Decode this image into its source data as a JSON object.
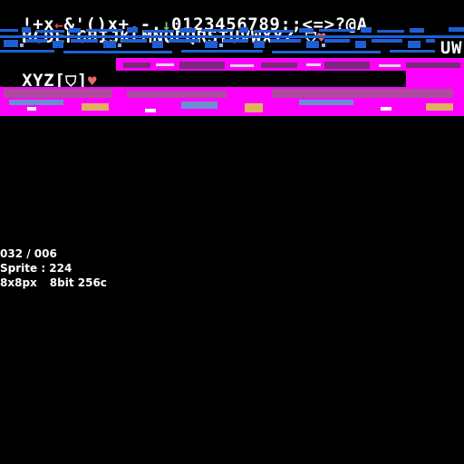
{
  "sheet": {
    "row1_text": "!+x",
    "row1_text2": "&'()x+,-.",
    "row1_text3": "0123456789:;<=>?@A",
    "row2_text": "BCDEFGHIJKLMNOPQRSTUVWXYZ",
    "row2_tail": "UW",
    "row3_text": "XYZ[",
    "row3_text2": "]",
    "icons": [
      "left-arrow-icon",
      "down-arrow-icon",
      "shield-icon",
      "heart-icon"
    ],
    "colors": {
      "background": "#000000",
      "font_white": "#ffffff",
      "blue": "#1f5fd6",
      "magenta": "#ff00ff",
      "heart": "#e86a6a",
      "arrow_red": "#e84a4a",
      "arrow_green": "#7ad06a"
    }
  },
  "info": {
    "index": "032 / 006",
    "sprite": "Sprite : 224",
    "size": "8x8px",
    "depth": "8bit 256c"
  }
}
